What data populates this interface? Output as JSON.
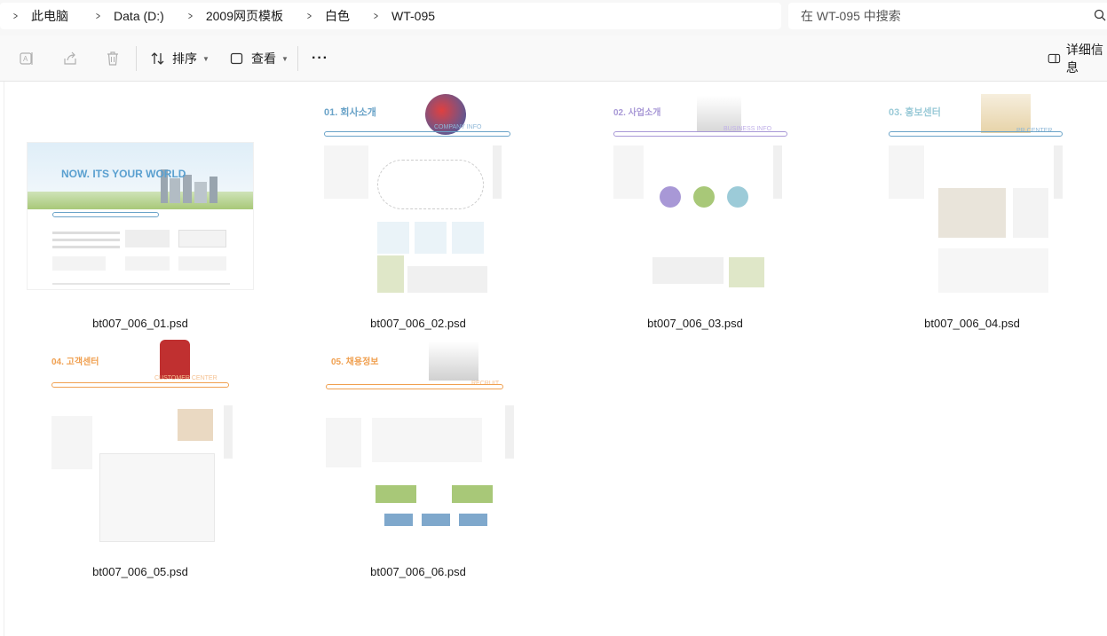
{
  "breadcrumb": {
    "items": [
      "此电脑",
      "Data (D:)",
      "2009网页模板",
      "白色",
      "WT-095"
    ]
  },
  "search": {
    "placeholder": "在 WT-095 中搜索"
  },
  "toolbar": {
    "sort_label": "排序",
    "view_label": "查看",
    "more_label": "···",
    "details_label": "详细信息"
  },
  "files": [
    {
      "name": "bt007_006_01.psd",
      "heading": "NOW. ITS YOUR WORLD",
      "tag": ""
    },
    {
      "name": "bt007_006_02.psd",
      "heading": "01. 회사소개",
      "tag": "COMPANY INFO"
    },
    {
      "name": "bt007_006_03.psd",
      "heading": "02. 사업소개",
      "tag": "BUSINESS INFO"
    },
    {
      "name": "bt007_006_04.psd",
      "heading": "03. 홍보센터",
      "tag": "PR CENTER"
    },
    {
      "name": "bt007_006_05.psd",
      "heading": "04. 고객센터",
      "tag": "CUSTOMER CENTER"
    },
    {
      "name": "bt007_006_06.psd",
      "heading": "05. 채용정보",
      "tag": "RECRUIT"
    }
  ],
  "colors": {
    "accent": "#6aa3c8",
    "purple": "#a898d6",
    "orange": "#f0a050",
    "red": "#c03030",
    "green": "#a8c878"
  }
}
